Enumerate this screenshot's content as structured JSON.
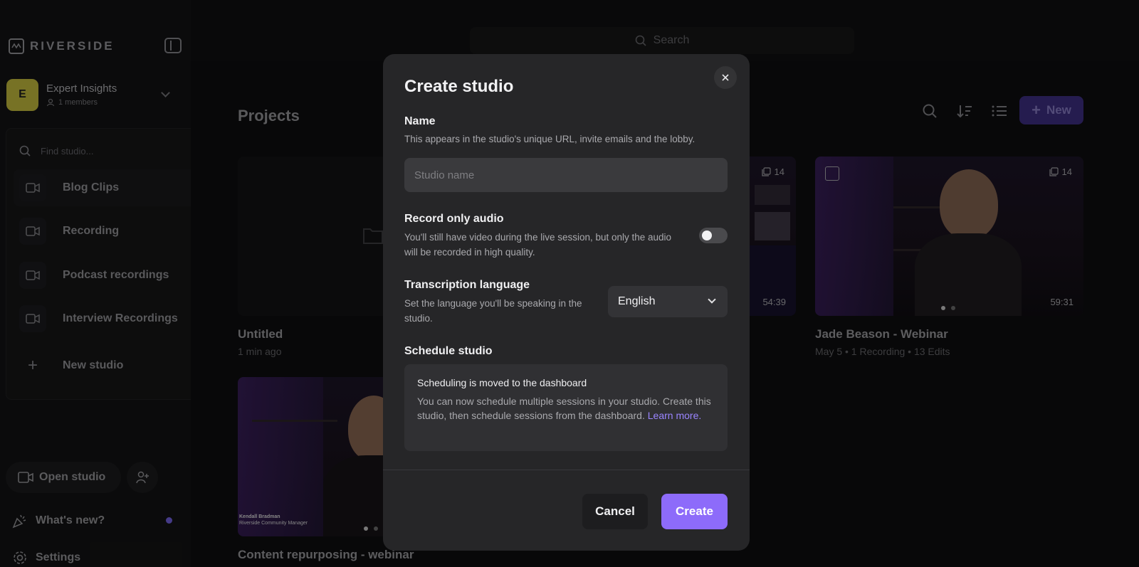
{
  "brand": {
    "name": "RIVERSIDE"
  },
  "workspace": {
    "initial": "E",
    "name": "Expert Insights",
    "members": "1 members"
  },
  "studio_finder": {
    "placeholder": "Find studio...",
    "items": [
      {
        "label": "Blog Clips",
        "active": true
      },
      {
        "label": "Recording"
      },
      {
        "label": "Podcast recordings"
      },
      {
        "label": "Interview Recordings"
      }
    ],
    "new_label": "New studio"
  },
  "sidebar_bottom": {
    "open_studio": "Open studio",
    "whats_new": "What's new?",
    "settings": "Settings"
  },
  "search": {
    "placeholder": "Search"
  },
  "projects": {
    "title": "Projects",
    "new_label": "New",
    "cards": [
      {
        "title": "Untitled",
        "meta": "1 min ago"
      },
      {
        "count": "14",
        "duration": "54:39"
      },
      {
        "title": "Jade Beason - Webinar",
        "meta": "May 5 • 1 Recording • 13 Edits",
        "count": "14",
        "duration": "59:31"
      },
      {
        "title": "Content repurposing - webinar",
        "caption_name": "Kendall Bradman",
        "caption_role": "Riverside Community Manager"
      }
    ]
  },
  "modal": {
    "title": "Create studio",
    "name_label": "Name",
    "name_help": "This appears in the studio's unique URL, invite emails and the lobby.",
    "name_placeholder": "Studio name",
    "audio_label": "Record only audio",
    "audio_help": "You'll still have video during the live session, but only the audio will be recorded in high quality.",
    "audio_enabled": false,
    "lang_label": "Transcription language",
    "lang_help": "Set the language you'll be speaking in the studio.",
    "lang_value": "English",
    "schedule_label": "Schedule studio",
    "schedule_title": "Scheduling is moved to the dashboard",
    "schedule_text": "You can now schedule multiple sessions in your studio. Create this studio, then schedule sessions from the dashboard.",
    "schedule_link": "Learn more.",
    "cancel_label": "Cancel",
    "create_label": "Create"
  },
  "colors": {
    "accent": "#8d6bfa",
    "link": "#9a85ff",
    "avatar": "#b7b03a"
  }
}
